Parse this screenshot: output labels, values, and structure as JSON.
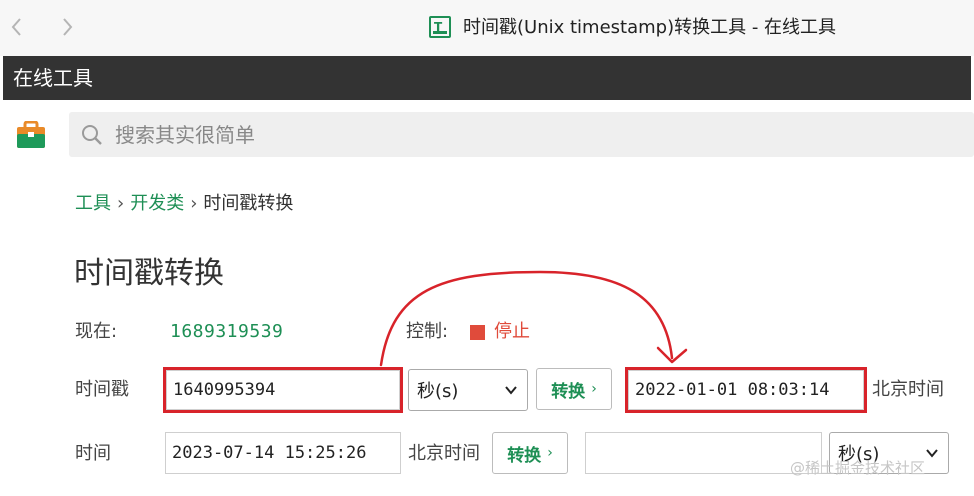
{
  "browser": {
    "back_icon": "chevron-left-icon",
    "forward_icon": "chevron-right-icon",
    "favicon_icon": "tool-logo-icon",
    "window_title": "时间戳(Unix timestamp)转换工具 - 在线工具"
  },
  "site": {
    "name": "在线工具"
  },
  "search": {
    "placeholder": "搜索其实很简单",
    "logo_icon": "toolbox-icon",
    "icon": "search-icon"
  },
  "breadcrumb": {
    "items": [
      "工具",
      "开发类"
    ],
    "current": "时间戳转换",
    "separator": "›"
  },
  "page": {
    "title": "时间戳转换"
  },
  "now_row": {
    "label": "现在:",
    "value": "1689319539",
    "control_label": "控制:",
    "stop_label": "停止",
    "stop_color": "#e04b3b"
  },
  "timestamp_row": {
    "label": "时间戳",
    "input_value": "1640995394",
    "unit_selected": "秒(s)",
    "convert_label": "转换",
    "convert_arrow": "›",
    "result_value": "2022-01-01 08:03:14",
    "result_zone": "北京时间"
  },
  "time_row": {
    "label": "时间",
    "input_value": "2023-07-14 15:25:26",
    "zone": "北京时间",
    "convert_label": "转换",
    "convert_arrow": "›",
    "result_value": "",
    "unit_selected": "秒(s)"
  },
  "colors": {
    "accent": "#1e8f55",
    "highlight": "#d8232a",
    "header_bg": "#333333"
  },
  "watermark": "@稀土掘金技术社区"
}
